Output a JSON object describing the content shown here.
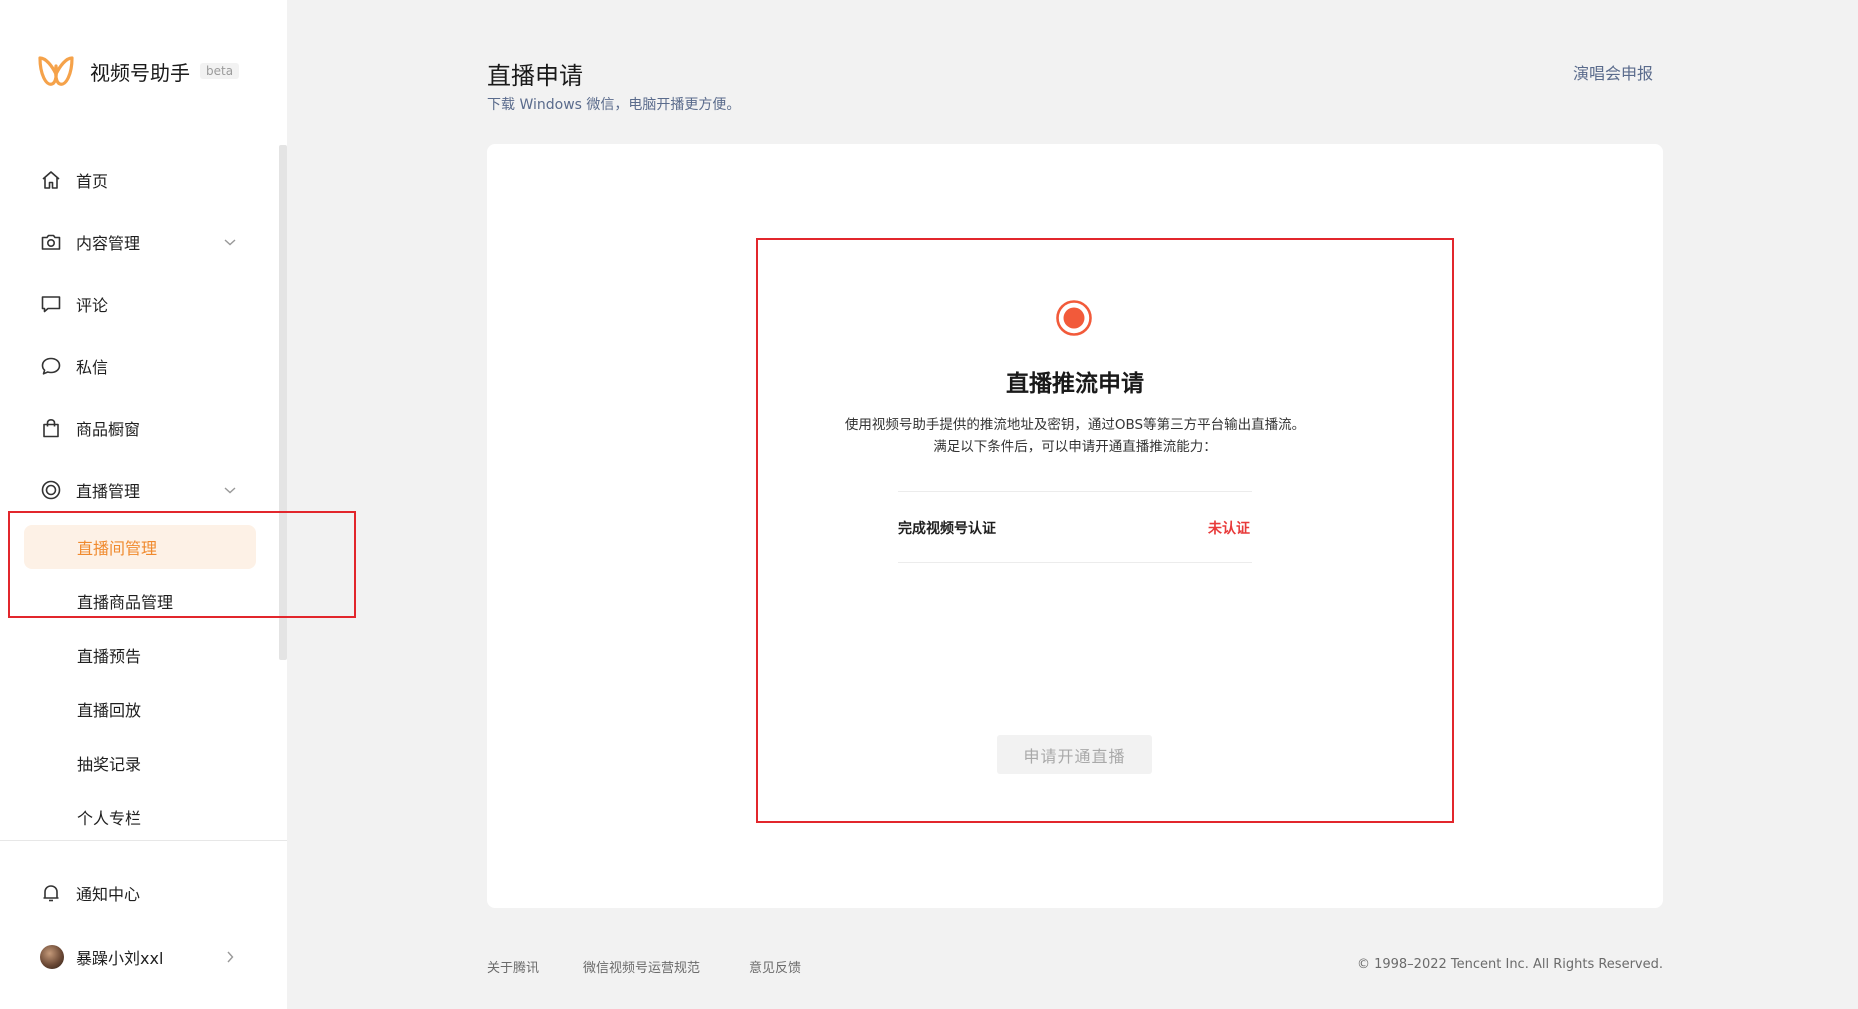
{
  "brand": {
    "name": "视频号助手",
    "beta": "beta",
    "logo_color": "#f5a24a"
  },
  "sidebar": {
    "items": [
      {
        "label": "首页",
        "icon": "home-icon"
      },
      {
        "label": "内容管理",
        "icon": "camera-icon"
      },
      {
        "label": "评论",
        "icon": "comment-icon"
      },
      {
        "label": "私信",
        "icon": "message-bubble-icon"
      },
      {
        "label": "商品橱窗",
        "icon": "shopping-bag-icon"
      },
      {
        "label": "直播管理",
        "icon": "live-circle-icon"
      }
    ],
    "live_sub_items": [
      {
        "label": "直播间管理",
        "active": true
      },
      {
        "label": "直播商品管理",
        "active": false
      },
      {
        "label": "直播预告",
        "active": false
      },
      {
        "label": "直播回放",
        "active": false
      },
      {
        "label": "抽奖记录",
        "active": false
      },
      {
        "label": "个人专栏",
        "active": false
      }
    ],
    "notification": {
      "label": "通知中心",
      "icon": "bell-icon"
    },
    "user": {
      "name": "暴躁小刘xxl"
    }
  },
  "header": {
    "title": "直播申请",
    "subtitle": "下载 Windows 微信，电脑开播更方便。",
    "top_link": "演唱会申报"
  },
  "panel": {
    "title": "直播推流申请",
    "desc_line1": "使用视频号助手提供的推流地址及密钥，通过OBS等第三方平台输出直播流。",
    "desc_line2": "满足以下条件后，可以申请开通直播推流能力：",
    "condition": {
      "label": "完成视频号认证",
      "status": "未认证"
    },
    "apply_button": "申请开通直播"
  },
  "footer": {
    "links": [
      "关于腾讯",
      "微信视频号运营规范",
      "意见反馈"
    ],
    "copyright": "© 1998–2022 Tencent Inc. All Rights Reserved."
  },
  "colors": {
    "accent": "#f08a2e",
    "active_bg": "#fdf1e6",
    "danger": "#e83a3a",
    "link": "#5a6b8c",
    "highlight_box": "#e2262c"
  }
}
